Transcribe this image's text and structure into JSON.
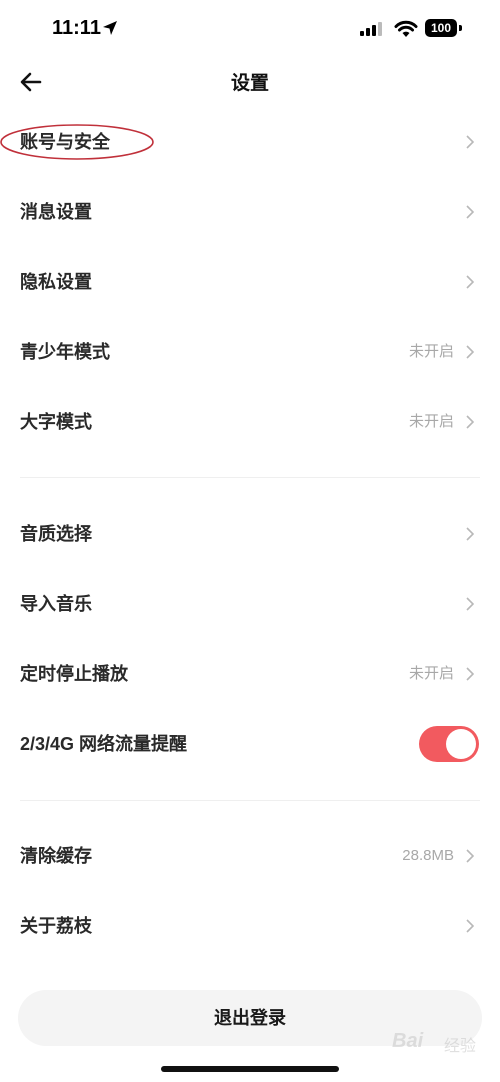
{
  "status_bar": {
    "time": "11:11",
    "battery": "100"
  },
  "header": {
    "title": "设置"
  },
  "section1": [
    {
      "label": "账号与安全",
      "value": ""
    },
    {
      "label": "消息设置",
      "value": ""
    },
    {
      "label": "隐私设置",
      "value": ""
    },
    {
      "label": "青少年模式",
      "value": "未开启"
    },
    {
      "label": "大字模式",
      "value": "未开启"
    }
  ],
  "section2": [
    {
      "label": "音质选择",
      "value": ""
    },
    {
      "label": "导入音乐",
      "value": ""
    },
    {
      "label": "定时停止播放",
      "value": "未开启"
    },
    {
      "label": "2/3/4G 网络流量提醒",
      "toggle_on": true
    }
  ],
  "section3": [
    {
      "label": "清除缓存",
      "value": "28.8MB"
    },
    {
      "label": "关于荔枝",
      "value": ""
    }
  ],
  "logout_label": "退出登录",
  "watermark": {
    "brand": "Bai",
    "suffix": "经验"
  },
  "colors": {
    "toggle_on": "#f25a5f",
    "annotation": "#c0303a",
    "value_text": "#a8a8a8"
  }
}
